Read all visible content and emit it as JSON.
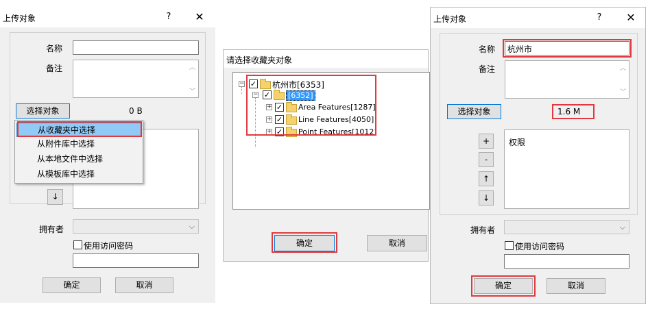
{
  "dialog1": {
    "title": "上传对象",
    "help": "?",
    "close": "✕",
    "name_label": "名称",
    "name_value": "",
    "note_label": "备注",
    "select_button": "选择对象",
    "size": "0 B",
    "menu": [
      "从收藏夹中选择",
      "从附件库中选择",
      "从本地文件中选择",
      "从模板库中选择"
    ],
    "down_arrow": "↓",
    "owner_label": "拥有者",
    "use_code_label": "使用访问密码",
    "ok": "确定",
    "cancel": "取消"
  },
  "dialog2": {
    "title": "请选择收藏夹对象",
    "tree": {
      "root": "杭州市[6353]",
      "child": "[6352]",
      "leaves": [
        "Area Features[1287]",
        "Line Features[4050]",
        "Point Features[1012]"
      ]
    },
    "ok": "确定",
    "cancel": "取消"
  },
  "dialog3": {
    "title": "上传对象",
    "help": "?",
    "close": "✕",
    "name_label": "名称",
    "name_value": "杭州市",
    "note_label": "备注",
    "select_button": "选择对象",
    "size": "1.6 M",
    "side_buttons": [
      "+",
      "-",
      "↑",
      "↓"
    ],
    "list_item": "权限",
    "owner_label": "拥有者",
    "use_code_label": "使用访问密码",
    "ok": "确定",
    "cancel": "取消"
  },
  "colors": {
    "highlight": "#e0393e",
    "selection": "#91c9f7",
    "dialog_bg": "#f0f0f0"
  }
}
